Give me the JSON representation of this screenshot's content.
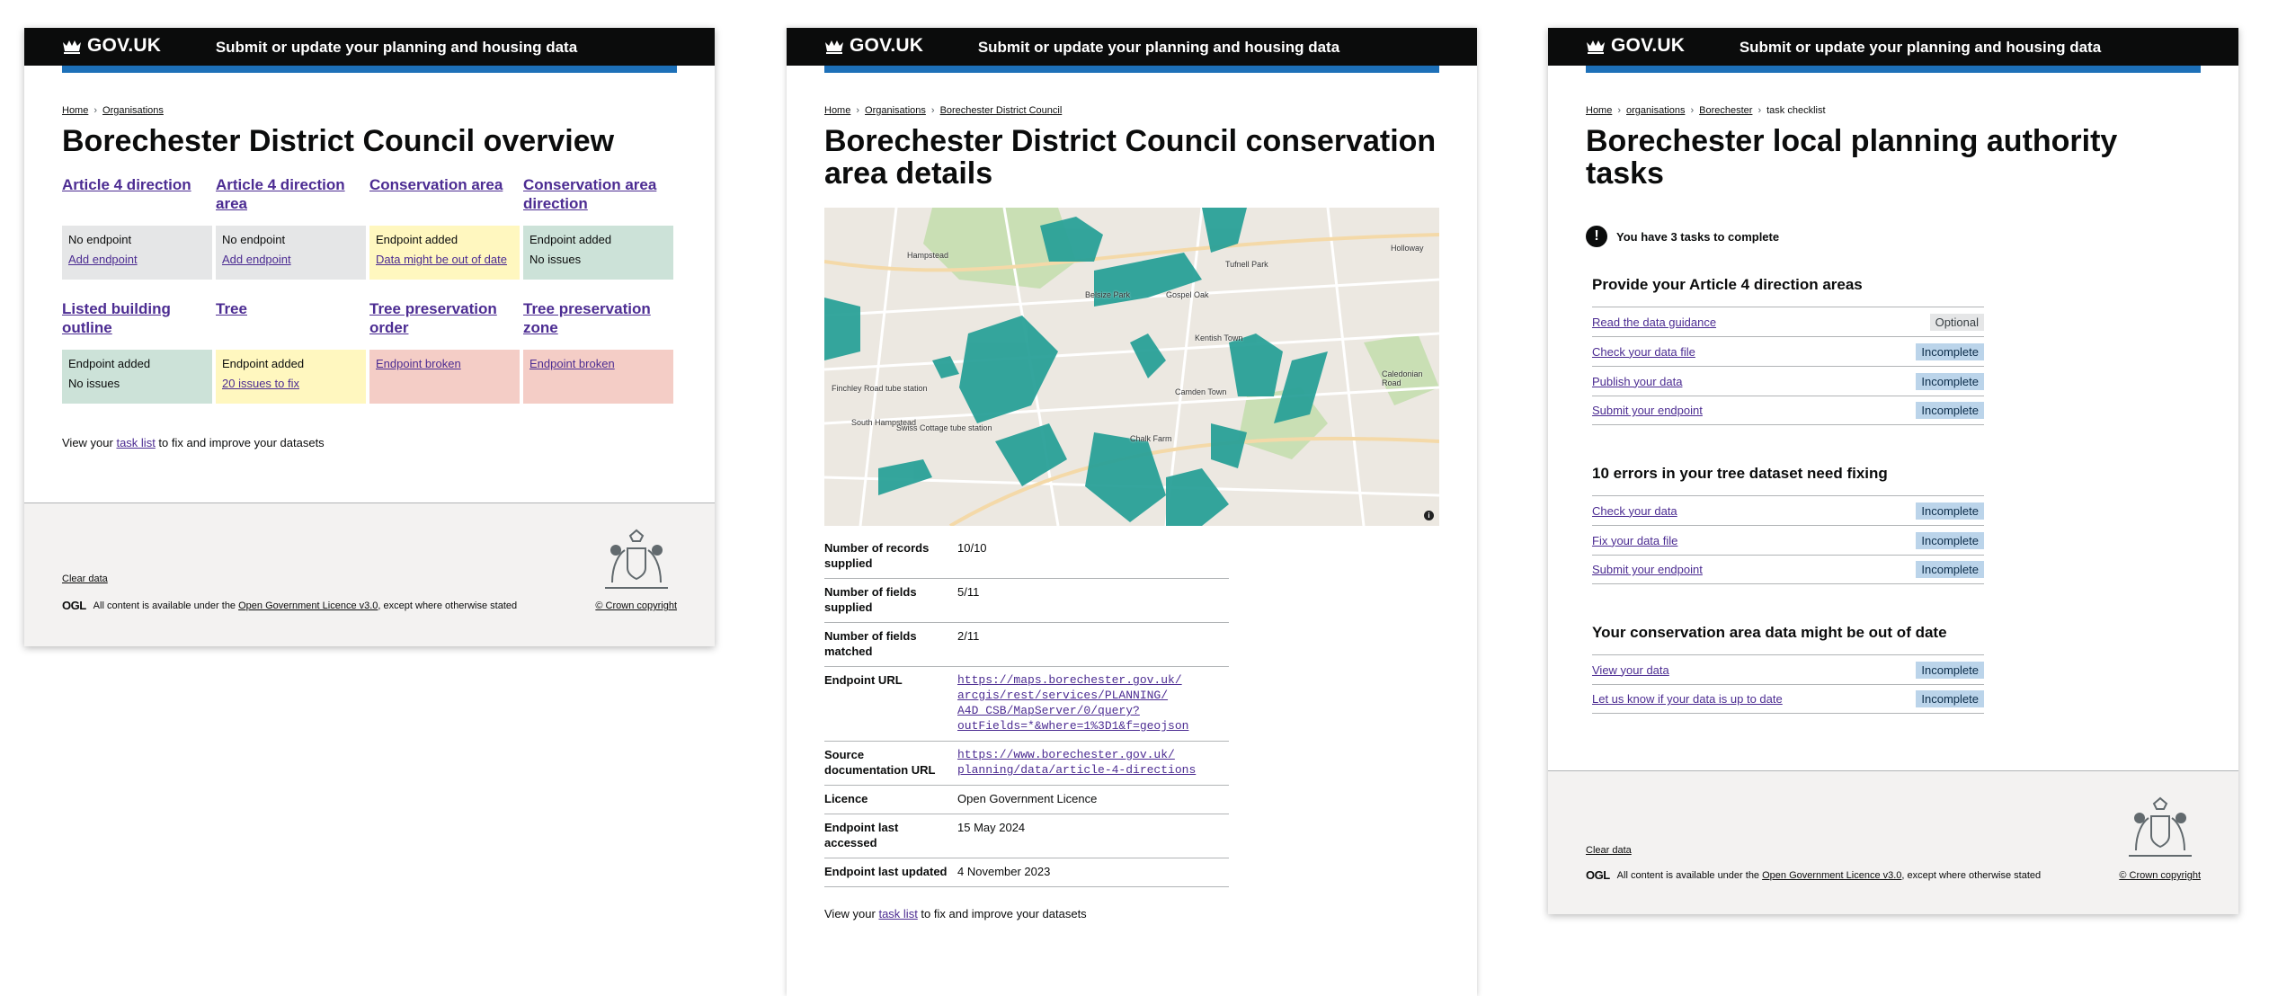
{
  "header": {
    "logo_text": "GOV.UK",
    "service_name": "Submit or update your planning and housing data",
    "accent_color": "#1d70b8"
  },
  "panel1": {
    "breadcrumbs": [
      "Home",
      "Organisations"
    ],
    "title": "Borechester District Council overview",
    "datasets": [
      {
        "name": "Article 4 direction",
        "status_text": "No endpoint",
        "action": "Add endpoint",
        "color": "grey"
      },
      {
        "name": "Article 4 direction area",
        "status_text": "No endpoint",
        "action": "Add endpoint",
        "color": "grey"
      },
      {
        "name": "Conservation area",
        "status_text": "Endpoint added",
        "action": "Data might be out of date",
        "color": "yellow"
      },
      {
        "name": "Conservation area direction",
        "status_text": "Endpoint added",
        "action": "No issues",
        "color": "green"
      },
      {
        "name": "Listed building outline",
        "status_text": "Endpoint added",
        "action": "No issues",
        "color": "green"
      },
      {
        "name": "Tree",
        "status_text": "Endpoint added",
        "action": "20 issues to fix",
        "color": "yellow"
      },
      {
        "name": "Tree preservation order",
        "status_text": "",
        "action": "Endpoint broken",
        "color": "red"
      },
      {
        "name": "Tree preservation zone",
        "status_text": "",
        "action": "Endpoint broken",
        "color": "red"
      }
    ],
    "footnote": {
      "before": "View your ",
      "link": "task list",
      "after": " to fix and improve your datasets"
    }
  },
  "panel2": {
    "breadcrumbs": [
      "Home",
      "Organisations",
      "Borechester District Council"
    ],
    "title": "Borechester District Council conservation area details",
    "map_labels": [
      "Hampstead",
      "Belsize Park",
      "Gospel Oak",
      "Tufnell Park",
      "Kentish Town",
      "Camden Town",
      "Chalk Farm",
      "South Hampstead",
      "Swiss Cottage tube station",
      "Finchley Road tube station",
      "Holloway",
      "Caledonian Road"
    ],
    "summary": [
      {
        "key": "Number of records supplied",
        "value": "10/10"
      },
      {
        "key": "Number of fields supplied",
        "value": "5/11"
      },
      {
        "key": "Number of fields matched",
        "value": "2/11"
      },
      {
        "key": "Endpoint URL",
        "lines": [
          "https://maps.borechester.gov.uk/",
          "arcgis/rest/services/PLANNING/",
          "A4D_CSB/MapServer/0/query?",
          "outFields=*&where=1%3D1&f=geojson"
        ]
      },
      {
        "key": "Source documentation URL",
        "lines": [
          "https://www.borechester.gov.uk/",
          "planning/data/article-4-directions"
        ]
      },
      {
        "key": "Licence",
        "value": "Open Government Licence"
      },
      {
        "key": "Endpoint last accessed",
        "value": "15 May 2024"
      },
      {
        "key": "Endpoint last updated",
        "value": "4 November 2023"
      }
    ],
    "footnote": {
      "before": "View your ",
      "link": "task list",
      "after": " to fix and improve your datasets"
    }
  },
  "panel3": {
    "breadcrumbs": [
      "Home",
      "organisations",
      "Borechester",
      "task checklist"
    ],
    "title": "Borechester local planning authority tasks",
    "warning": "You have 3 tasks to complete",
    "sections": [
      {
        "heading": "Provide your Article 4 direction areas",
        "tasks": [
          {
            "label": "Read the data guidance",
            "tag": "Optional"
          },
          {
            "label": "Check your data file",
            "tag": "Incomplete"
          },
          {
            "label": "Publish your data",
            "tag": "Incomplete"
          },
          {
            "label": "Submit your endpoint",
            "tag": "Incomplete"
          }
        ]
      },
      {
        "heading": "10 errors in your tree dataset need fixing",
        "tasks": [
          {
            "label": "Check your data",
            "tag": "Incomplete"
          },
          {
            "label": "Fix your data file",
            "tag": "Incomplete"
          },
          {
            "label": "Submit your endpoint",
            "tag": "Incomplete"
          }
        ]
      },
      {
        "heading": "Your conservation area data might be out of date",
        "tasks": [
          {
            "label": "View your data",
            "tag": "Incomplete"
          },
          {
            "label": "Let us know if your data is up to date",
            "tag": "Incomplete"
          }
        ]
      }
    ]
  },
  "footer": {
    "clear_data": "Clear data",
    "ogl_mark": "OGL",
    "licence_before": "All content is available under the ",
    "licence_link": "Open Government Licence v3.0",
    "licence_after": ", except where otherwise stated",
    "copyright": "© Crown copyright"
  }
}
